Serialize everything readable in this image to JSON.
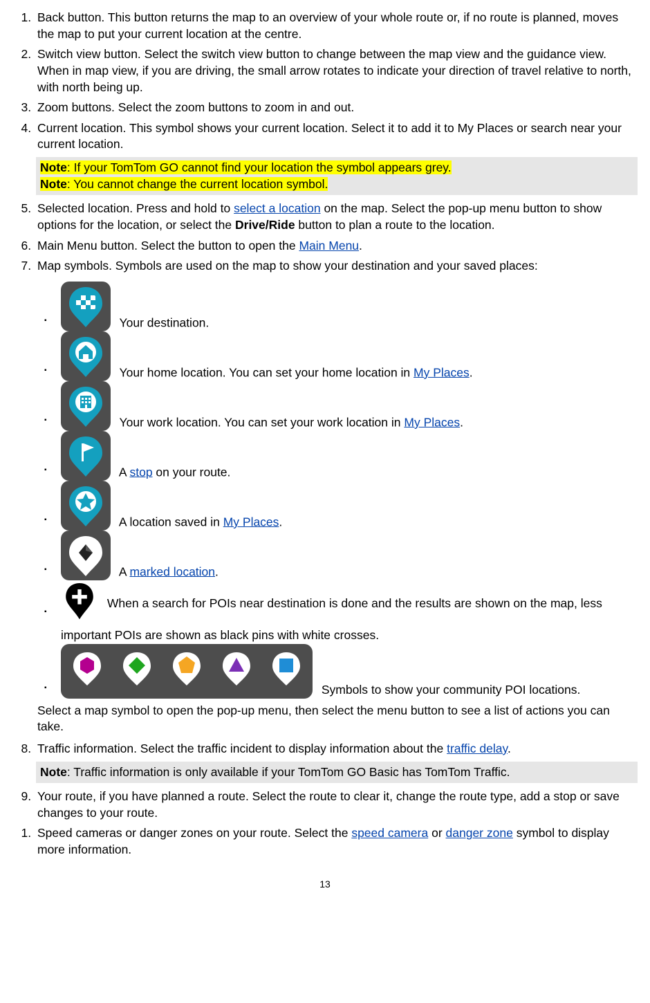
{
  "items": {
    "i1": {
      "num": "1.",
      "text": "Back button. This button returns the map to an overview of your whole route or, if no route is planned, moves the map to put your current location at the centre."
    },
    "i2": {
      "num": "2.",
      "text": "Switch view button. Select the switch view button to change between the map view and the guidance view. When in map view, if you are driving, the small arrow rotates to indicate your direction of travel relative to north, with north being up."
    },
    "i3": {
      "num": "3.",
      "text": "Zoom buttons. Select the zoom buttons to zoom in and out."
    },
    "i4": {
      "num": "4.",
      "text": "Current location. This symbol shows your current location. Select it to add it to My Places or search near your current location."
    },
    "i4_note1_label": "Note",
    "i4_note1_rest": ": If your TomTom GO cannot find your location the symbol appears grey.",
    "i4_note2_label": "Note",
    "i4_note2_rest": ": You cannot change the current location symbol.",
    "i5_a": "Selected location. Press and hold to ",
    "i5_link": "select a location",
    "i5_b": " on the map. Select the pop-up menu button to show options for the location, or select the ",
    "i5_bold": "Drive/Ride",
    "i5_c": " button to plan a route to the location.",
    "i6_a": "Main Menu button. Select the button to open the ",
    "i6_link": "Main Menu",
    "i6_b": ".",
    "i7_intro": "Map symbols. Symbols are used on the map to show your destination and your saved places:",
    "sym": {
      "dest": "Your destination.",
      "home_a": "Your home location. You can set your home location in ",
      "home_link": "My Places",
      "home_b": ".",
      "work_a": "Your work location. You can set your work location in ",
      "work_link": "My Places",
      "work_b": ".",
      "stop_a": "A ",
      "stop_link": "stop",
      "stop_b": " on your route.",
      "saved_a": "A location saved in ",
      "saved_link": "My Places",
      "saved_b": ".",
      "marked_a": "A ",
      "marked_link": "marked location",
      "marked_b": ".",
      "poi": "When a search for POIs near destination is done and the results are shown on the map, less important POIs are shown as black pins with white crosses.",
      "community": "Symbols to show your community POI locations."
    },
    "i7_after": "Select a map symbol to open the pop-up menu, then select the menu button to see a list of actions you can take.",
    "i8_a": "Traffic information. Select the traffic incident to display information about the ",
    "i8_link": "traffic delay",
    "i8_b": ".",
    "i8_note_label": "Note",
    "i8_note_rest": ": Traffic information is only available if your TomTom GO Basic has TomTom Traffic.",
    "i9": "Your route, if you have planned a route. Select the route to clear it, change the route type, add a stop or save changes to your route.",
    "i10_a": "Speed cameras or danger zones on your route. Select the ",
    "i10_link1": "speed camera",
    "i10_mid": " or ",
    "i10_link2": "danger zone",
    "i10_b": "   symbol to display more information."
  },
  "page_number": "13"
}
